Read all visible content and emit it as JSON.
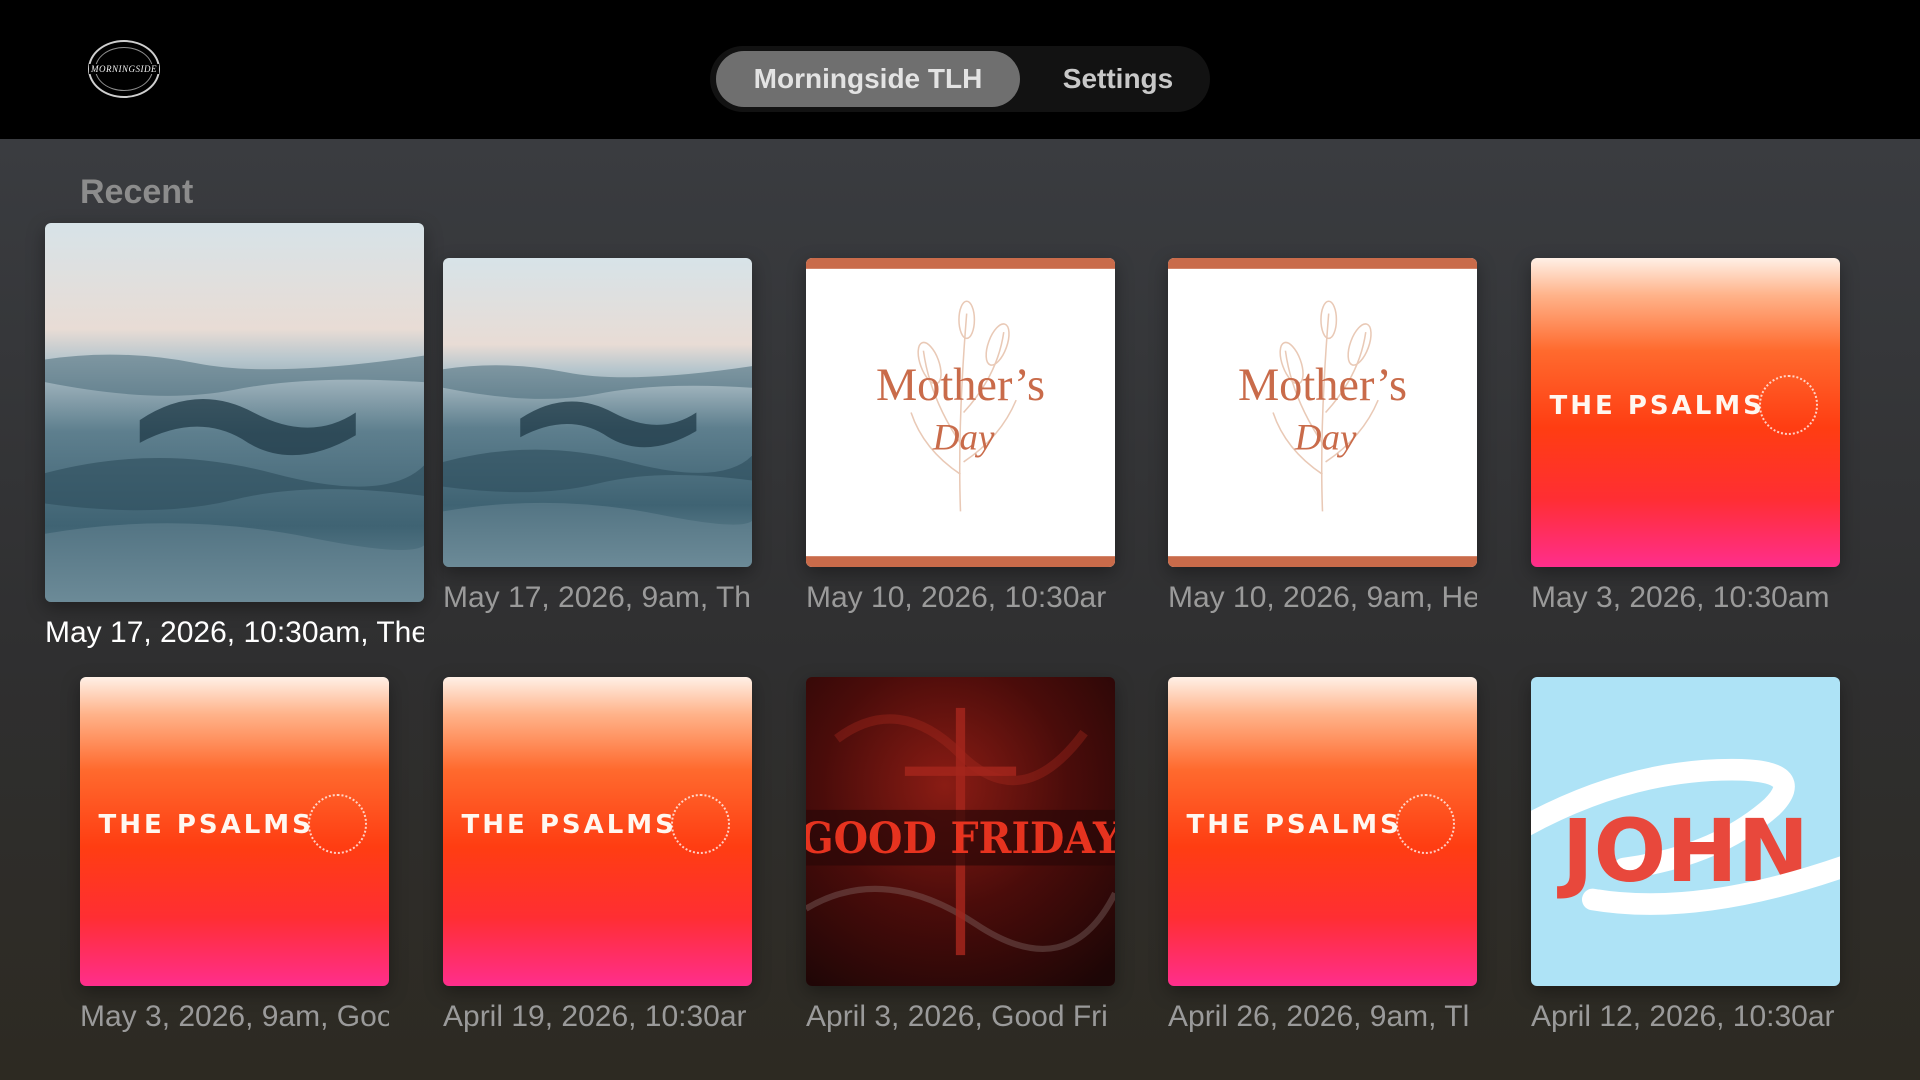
{
  "header": {
    "logo_text": "MORNINGSIDE",
    "tabs": [
      {
        "label": "Morningside TLH",
        "selected": true
      },
      {
        "label": "Settings",
        "selected": false
      }
    ]
  },
  "section": {
    "title": "Recent"
  },
  "items": [
    {
      "caption": "May 17, 2026, 10:30am, The",
      "art": "ocean-waves",
      "focused": true
    },
    {
      "caption": "May 17, 2026, 9am, Th",
      "art": "ocean-waves"
    },
    {
      "caption": "May 10, 2026, 10:30ar",
      "art": "mothers-day",
      "art_text": [
        "Mother’s",
        "Day"
      ]
    },
    {
      "caption": "May 10, 2026, 9am, He",
      "art": "mothers-day",
      "art_text": [
        "Mother’s",
        "Day"
      ]
    },
    {
      "caption": "May 3, 2026, 10:30am",
      "art": "the-psalms",
      "art_text": "THE PSALMS"
    },
    {
      "caption": "May 3, 2026, 9am, Goo",
      "art": "the-psalms",
      "art_text": "THE PSALMS"
    },
    {
      "caption": "April 19, 2026, 10:30ar",
      "art": "the-psalms",
      "art_text": "THE PSALMS"
    },
    {
      "caption": "April 3, 2026, Good Fri",
      "art": "good-friday",
      "art_text": "GOOD FRIDAY"
    },
    {
      "caption": "April 26, 2026, 9am, Tl",
      "art": "the-psalms",
      "art_text": "THE PSALMS"
    },
    {
      "caption": "April 12, 2026, 10:30ar",
      "art": "john",
      "art_text": "JOHN"
    }
  ],
  "colors": {
    "accent_tab": "#6f6f6f",
    "psalms_orange": "#ff3d12",
    "mothers_day_terracotta": "#c96b4a",
    "john_sky": "#aee3f6",
    "john_red": "#e8483c"
  }
}
